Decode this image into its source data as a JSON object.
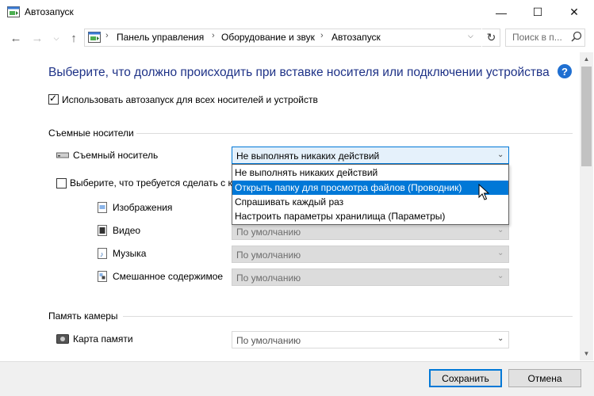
{
  "window": {
    "title": "Автозапуск",
    "controls": {
      "minimize": "—",
      "maximize": "☐",
      "close": "✕"
    }
  },
  "nav": {
    "back_icon": "arrow-left-icon",
    "forward_icon": "arrow-right-icon",
    "recent_icon": "chevron-down-icon",
    "up_icon": "arrow-up-icon",
    "breadcrumbs": [
      "Панель управления",
      "Оборудование и звук",
      "Автозапуск"
    ],
    "separator": "›",
    "search_placeholder": "Поиск в п..."
  },
  "heading": "Выберите, что должно происходить при вставке носителя или подключении устройства",
  "autoplay_checkbox": {
    "label": "Использовать автозапуск для всех носителей и устройств",
    "checked": true
  },
  "removable": {
    "section_title": "Съемные носители",
    "device_label": "Съемный носитель",
    "selected": "Не выполнять никаких действий",
    "options": [
      "Не выполнять никаких действий",
      "Открыть папку для просмотра файлов (Проводник)",
      "Спрашивать каждый раз",
      "Настроить параметры хранилища (Параметры)"
    ],
    "highlighted_index": 1,
    "per_type_checkbox_label": "Выберите, что требуется сделать с ка",
    "per_type_checked": false,
    "types": [
      {
        "label": "Изображения",
        "value": ""
      },
      {
        "label": "Видео",
        "value": "По умолчанию"
      },
      {
        "label": "Музыка",
        "value": "По умолчанию"
      },
      {
        "label": "Смешанное содержимое",
        "value": "По умолчанию"
      }
    ]
  },
  "camera": {
    "section_title": "Память камеры",
    "device_label": "Карта памяти",
    "value": "По умолчанию"
  },
  "footer": {
    "save": "Сохранить",
    "cancel": "Отмена"
  },
  "colors": {
    "heading": "#1e3287",
    "accent": "#0078d7",
    "help": "#1f6fd1"
  }
}
